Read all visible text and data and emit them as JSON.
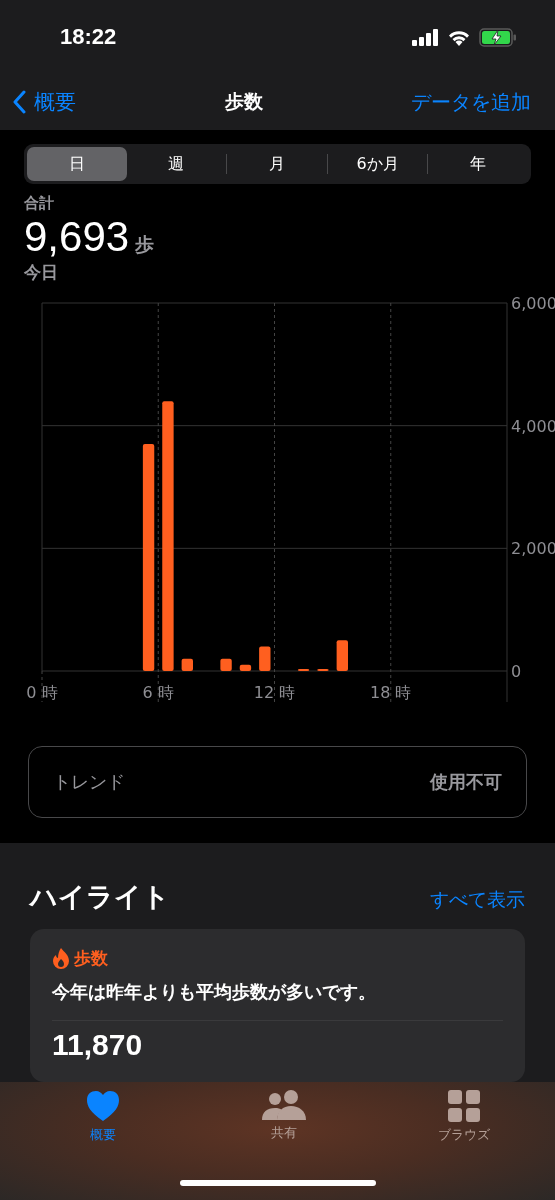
{
  "status_bar": {
    "time": "18:22"
  },
  "nav": {
    "back": "概要",
    "title": "歩数",
    "action": "データを追加"
  },
  "segments": [
    {
      "label": "日",
      "selected": true
    },
    {
      "label": "週",
      "selected": false
    },
    {
      "label": "月",
      "selected": false
    },
    {
      "label": "6か月",
      "selected": false
    },
    {
      "label": "年",
      "selected": false
    }
  ],
  "summary": {
    "label": "合計",
    "value": "9,693",
    "unit": "歩",
    "date": "今日"
  },
  "chart_data": {
    "type": "bar",
    "x": [
      5.5,
      6.5,
      7.5,
      9.5,
      10.5,
      11.5,
      13.5,
      14.5,
      15.5
    ],
    "xlim": [
      0,
      24
    ],
    "grid": true,
    "series": [
      {
        "color": "#ff5f1f",
        "values": [
          3700,
          4400,
          200,
          200,
          100,
          400,
          10,
          10,
          500
        ]
      }
    ],
    "ylim": [
      0,
      6000
    ],
    "yticks": [
      0,
      {
        "value": 2000,
        "label": "2,000"
      },
      {
        "value": 4000,
        "label": "4,000"
      },
      {
        "value": 6000,
        "label": "6,000"
      }
    ],
    "xticks": [
      {
        "value": 0,
        "label": "0 時"
      },
      {
        "value": 6,
        "label": "6 時"
      },
      {
        "value": 12,
        "label": "12 時"
      },
      {
        "value": 18,
        "label": "18 時"
      }
    ]
  },
  "trend": {
    "label": "トレンド",
    "value": "使用不可"
  },
  "highlights": {
    "title": "ハイライト",
    "link": "すべて表示",
    "card": {
      "category": "歩数",
      "text": "今年は昨年よりも平均歩数が多いです。",
      "value": "11,870"
    }
  },
  "tab_bar": [
    {
      "label": "概要",
      "selected": true
    },
    {
      "label": "共有",
      "selected": false
    },
    {
      "label": "ブラウズ",
      "selected": false
    }
  ]
}
